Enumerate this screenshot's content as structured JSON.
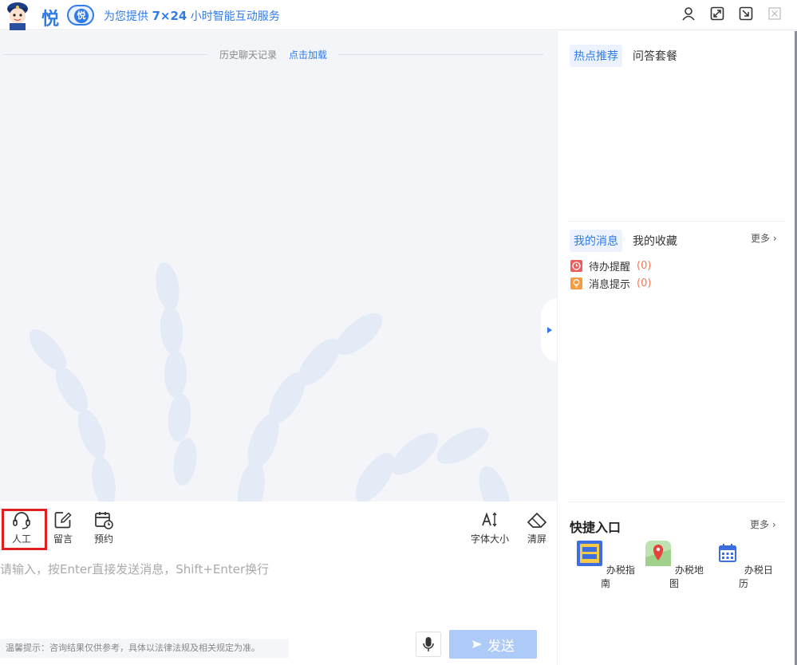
{
  "header": {
    "brand": "悦",
    "badge": "悦",
    "tagline_prefix": "为您提供 ",
    "tagline_bold": "7×24",
    "tagline_suffix": " 小时智能互动服务"
  },
  "chat": {
    "history_label": "历史聊天记录",
    "load_link": "点击加载"
  },
  "toolbar": {
    "human": "人工",
    "message": "留言",
    "appointment": "预约",
    "font_size": "字体大小",
    "clear": "清屏"
  },
  "input": {
    "placeholder": "请输入，按Enter直接发送消息，Shift+Enter换行",
    "tip": "温馨提示：咨询结果仅供参考，具体以法律法规及相关规定为准。",
    "send": "发送"
  },
  "right": {
    "tabs_top": [
      "热点推荐",
      "问答套餐"
    ],
    "tabs_msg": [
      "我的消息",
      "我的收藏"
    ],
    "more": "更多",
    "messages": [
      {
        "label": "待办提醒",
        "count": "(0)"
      },
      {
        "label": "消息提示",
        "count": "(0)"
      }
    ],
    "quick_title": "快捷入口",
    "quick_items": [
      "办税指南",
      "办税地图",
      "办税日历"
    ]
  },
  "colors": {
    "accent": "#2f7bea",
    "send_disabled": "#aecbf7",
    "highlight": "#e02020"
  }
}
